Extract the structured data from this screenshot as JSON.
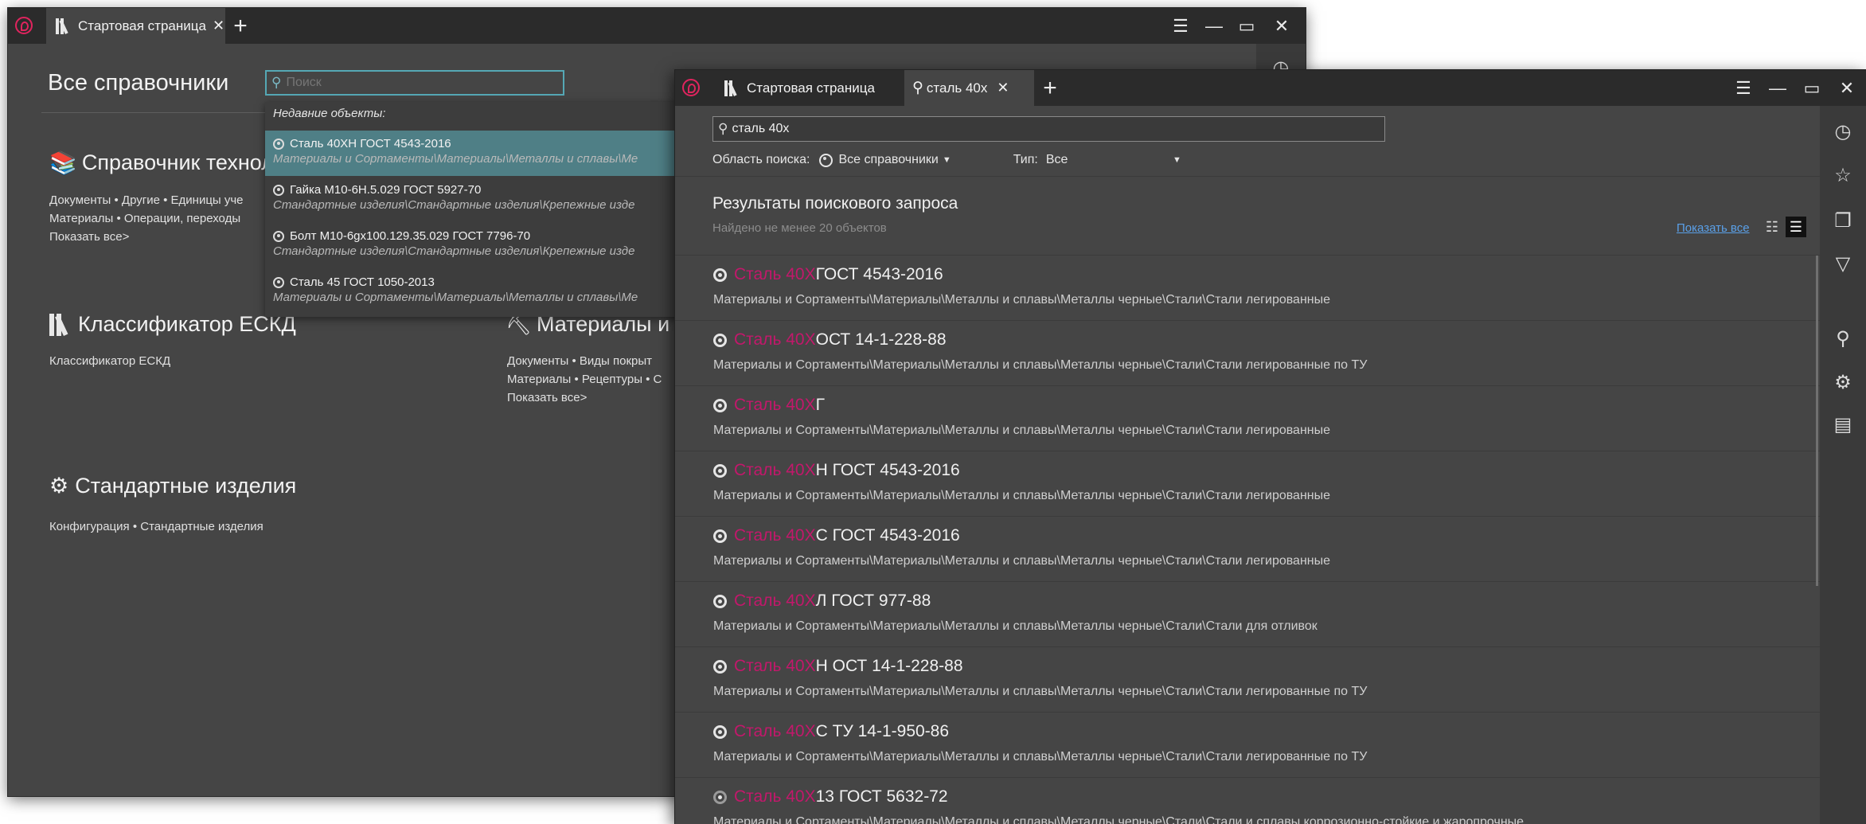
{
  "window1": {
    "tab_label": "Стартовая страница",
    "tab_close": "✕",
    "new_tab": "+",
    "menu_icon": "☰",
    "minimize_icon": "—",
    "maximize_icon": "▭",
    "close_icon": "✕",
    "page_title": "Все справочники",
    "search_placeholder": "Поиск",
    "dropdown": {
      "header": "Недавние объекты:",
      "items": [
        {
          "title": "Сталь 40ХН ГОСТ 4543-2016",
          "path": "Материалы и Сортаменты\\Материалы\\Металлы и сплавы\\Ме"
        },
        {
          "title": "Гайка М10-6Н.5.029 ГОСТ 5927-70",
          "path": "Стандартные изделия\\Стандартные изделия\\Крепежные изде"
        },
        {
          "title": "Болт М10-6gx100.129.35.029 ГОСТ 7796-70",
          "path": "Стандартные изделия\\Стандартные изделия\\Крепежные изде"
        },
        {
          "title": "Сталь 45 ГОСТ 1050-2013",
          "path": "Материалы и Сортаменты\\Материалы\\Металлы и сплавы\\Ме"
        }
      ]
    },
    "sections": {
      "tech": {
        "title": "Справочник техноло",
        "line1": "Документы • Другие • Единицы уче",
        "line2": "Материалы • Операции, переходы",
        "show_all": "Показать все>"
      },
      "eskd": {
        "title": "Классификатор ЕСКД",
        "line1": "Классификатор ЕСКД"
      },
      "materials": {
        "title": "Материалы и С",
        "line1": "Документы • Виды покрыт",
        "line2": "Материалы • Рецептуры • С",
        "show_all": "Показать все>"
      },
      "std": {
        "title": "Стандартные изделия",
        "line1": "Конфигурация • Стандартные изделия"
      }
    }
  },
  "window2": {
    "tab_start": "Стартовая страница",
    "tab_search": "сталь 40х",
    "tab_close": "✕",
    "new_tab": "+",
    "menu_icon": "☰",
    "minimize_icon": "—",
    "maximize_icon": "▭",
    "close_icon": "✕",
    "search_value": "сталь 40х",
    "scope_label": "Область поиска:",
    "scope_value": "Все справочники",
    "type_label": "Тип:",
    "type_value": "Все",
    "results_title": "Результаты поискового запроса",
    "results_count": "Найдено не менее 20 объектов",
    "show_all": "Показать все",
    "results": [
      {
        "hl": "Сталь 40Х",
        "rest": " ГОСТ 4543-2016",
        "path": "Материалы и Сортаменты\\Материалы\\Металлы и сплавы\\Металлы черные\\Стали\\Стали легированные"
      },
      {
        "hl": "Сталь 40Х",
        "rest": " ОСТ 14-1-228-88",
        "path": "Материалы и Сортаменты\\Материалы\\Металлы и сплавы\\Металлы черные\\Стали\\Стали легированные по ТУ"
      },
      {
        "hl": "Сталь 40Х",
        "rest": "Г",
        "path": "Материалы и Сортаменты\\Материалы\\Металлы и сплавы\\Металлы черные\\Стали\\Стали легированные"
      },
      {
        "hl": "Сталь 40Х",
        "rest": "Н ГОСТ 4543-2016",
        "path": "Материалы и Сортаменты\\Материалы\\Металлы и сплавы\\Металлы черные\\Стали\\Стали легированные"
      },
      {
        "hl": "Сталь 40Х",
        "rest": "С ГОСТ 4543-2016",
        "path": "Материалы и Сортаменты\\Материалы\\Металлы и сплавы\\Металлы черные\\Стали\\Стали легированные"
      },
      {
        "hl": "Сталь 40Х",
        "rest": "Л ГОСТ 977-88",
        "path": "Материалы и Сортаменты\\Материалы\\Металлы и сплавы\\Металлы черные\\Стали\\Стали для отливок"
      },
      {
        "hl": "Сталь 40Х",
        "rest": "Н ОСТ 14-1-228-88",
        "path": "Материалы и Сортаменты\\Материалы\\Металлы и сплавы\\Металлы черные\\Стали\\Стали легированные по ТУ"
      },
      {
        "hl": "Сталь 40Х",
        "rest": "С ТУ 14-1-950-86",
        "path": "Материалы и Сортаменты\\Материалы\\Металлы и сплавы\\Металлы черные\\Стали\\Стали легированные по ТУ"
      },
      {
        "hl": "Сталь 40Х",
        "rest": "13 ГОСТ 5632-72",
        "path": "Материалы и Сортаменты\\Материалы\\Металлы и сплавы\\Металлы черные\\Стали\\Стали и сплавы коррозионно-стойкие и жаропрочные"
      }
    ]
  },
  "colors": {
    "accent": "#c2186b",
    "highlight_row": "#4f7f86",
    "link": "#5aa0e8",
    "logo": "#e0245e"
  }
}
